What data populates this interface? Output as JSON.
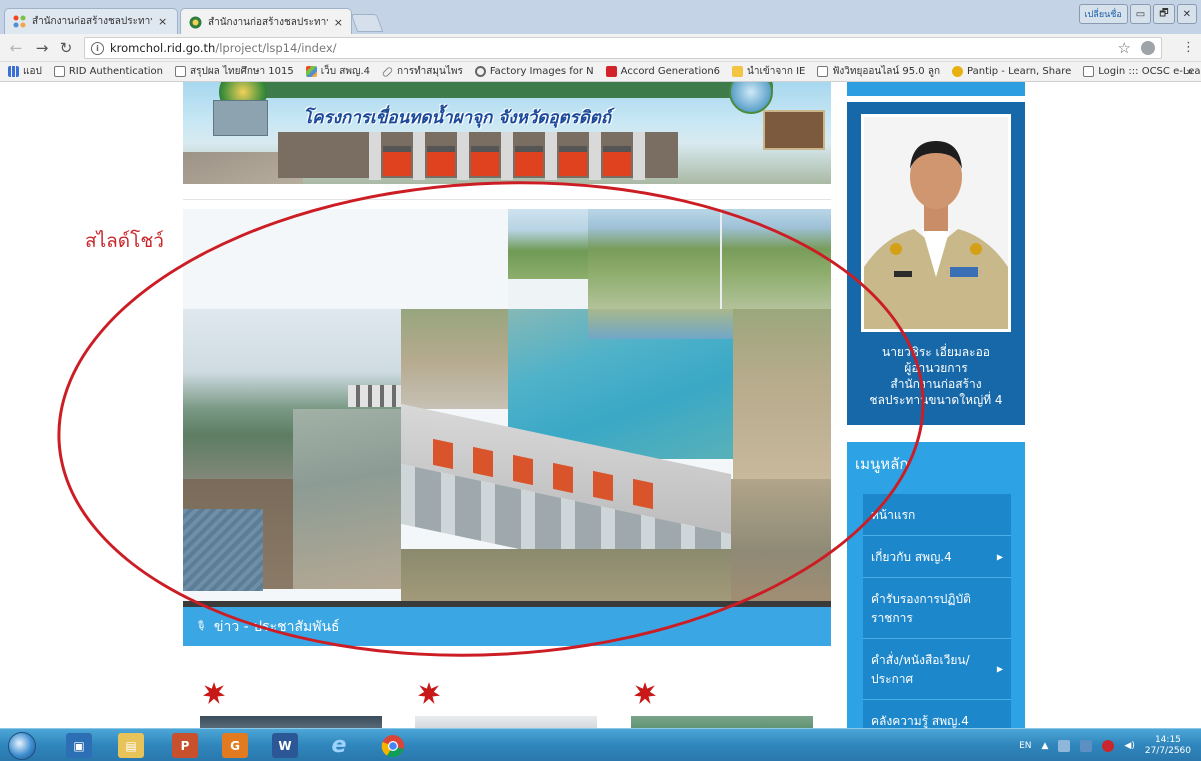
{
  "browser": {
    "tabs": [
      {
        "title": "สำนักงานก่อสร้างชลประทานฯ",
        "close": "×"
      },
      {
        "title": "สำนักงานก่อสร้างชลประทานฯ",
        "close": "×"
      }
    ],
    "window_buttons": [
      "เปลี่ยนชื่อ",
      "▭",
      "🗗",
      "✕"
    ],
    "url_domain": "kromchol.rid.go.th",
    "url_path": "/lproject/lsp14/index/",
    "info_icon": "i",
    "bookmarks": [
      {
        "label": "แอป",
        "icon": "apps-icon"
      },
      {
        "label": "RID Authentication",
        "icon": "page-icon"
      },
      {
        "label": "สรุปผล ไทยศึกษา 1015",
        "icon": "page-icon"
      },
      {
        "label": "เว็บ สพญ.4",
        "icon": "joomla-icon"
      },
      {
        "label": "การทำสมุนไพร",
        "icon": "link-icon"
      },
      {
        "label": "Factory Images for N",
        "icon": "android-icon"
      },
      {
        "label": "Accord Generation6",
        "icon": "red-icon"
      },
      {
        "label": "นำเข้าจาก IE",
        "icon": "folder-icon"
      },
      {
        "label": "ฟังวิทยุออนไลน์ 95.0 ลูก",
        "icon": "page-icon"
      },
      {
        "label": "Pantip - Learn, Share",
        "icon": "pantip-icon"
      },
      {
        "label": "Login ::: OCSC e-Lear",
        "icon": "page-icon"
      }
    ],
    "bookmarks_more": "»",
    "colors": {
      "tabstrip": "#c4d3e6",
      "toolbar": "#f2f2f2"
    }
  },
  "page": {
    "banner_text": "โครงการเขื่อนทดน้ำผาจุก จังหวัดอุตรดิตถ์",
    "news_bar_label": "ข่าว - ประชาสัมพันธ์",
    "profile": {
      "name": "นายวชิระ เอี่ยมละออ",
      "position": "ผู้อำนวยการ",
      "office_line1": "สำนักงานก่อสร้าง",
      "office_line2": "ชลประทานขนาดใหญ่ที่ 4"
    },
    "main_menu": {
      "title": "เมนูหลัก",
      "items": [
        {
          "label": "หน้าแรก",
          "has_submenu": false
        },
        {
          "label": "เกี่ยวกับ สพญ.4",
          "has_submenu": true
        },
        {
          "label": "คำรับรองการปฏิบัติราชการ",
          "has_submenu": false
        },
        {
          "label": "คำสั่ง/หนังสือเวียน/ประกาศ",
          "has_submenu": true
        },
        {
          "label": "คลังความรู้ สพญ.4",
          "has_submenu": false
        }
      ]
    },
    "colors": {
      "sidebar_dark": "#1668a9",
      "menu_blue": "#2da2e4",
      "news_bar": "#3aa6e3"
    }
  },
  "annotation": {
    "label": "สไลด์โชว์",
    "color": "#c8282d"
  },
  "taskbar": {
    "apps": [
      "explorer-icon",
      "outlook-icon",
      "folder-icon",
      "powerpoint-icon",
      "pdf-icon",
      "word-icon",
      "ie-icon",
      "chrome-icon"
    ],
    "app_labels": {
      "powerpoint": "P",
      "pdf": "G",
      "word": "W",
      "ie": "e"
    },
    "language": "EN",
    "time": "14:15",
    "date": "27/7/2560"
  }
}
